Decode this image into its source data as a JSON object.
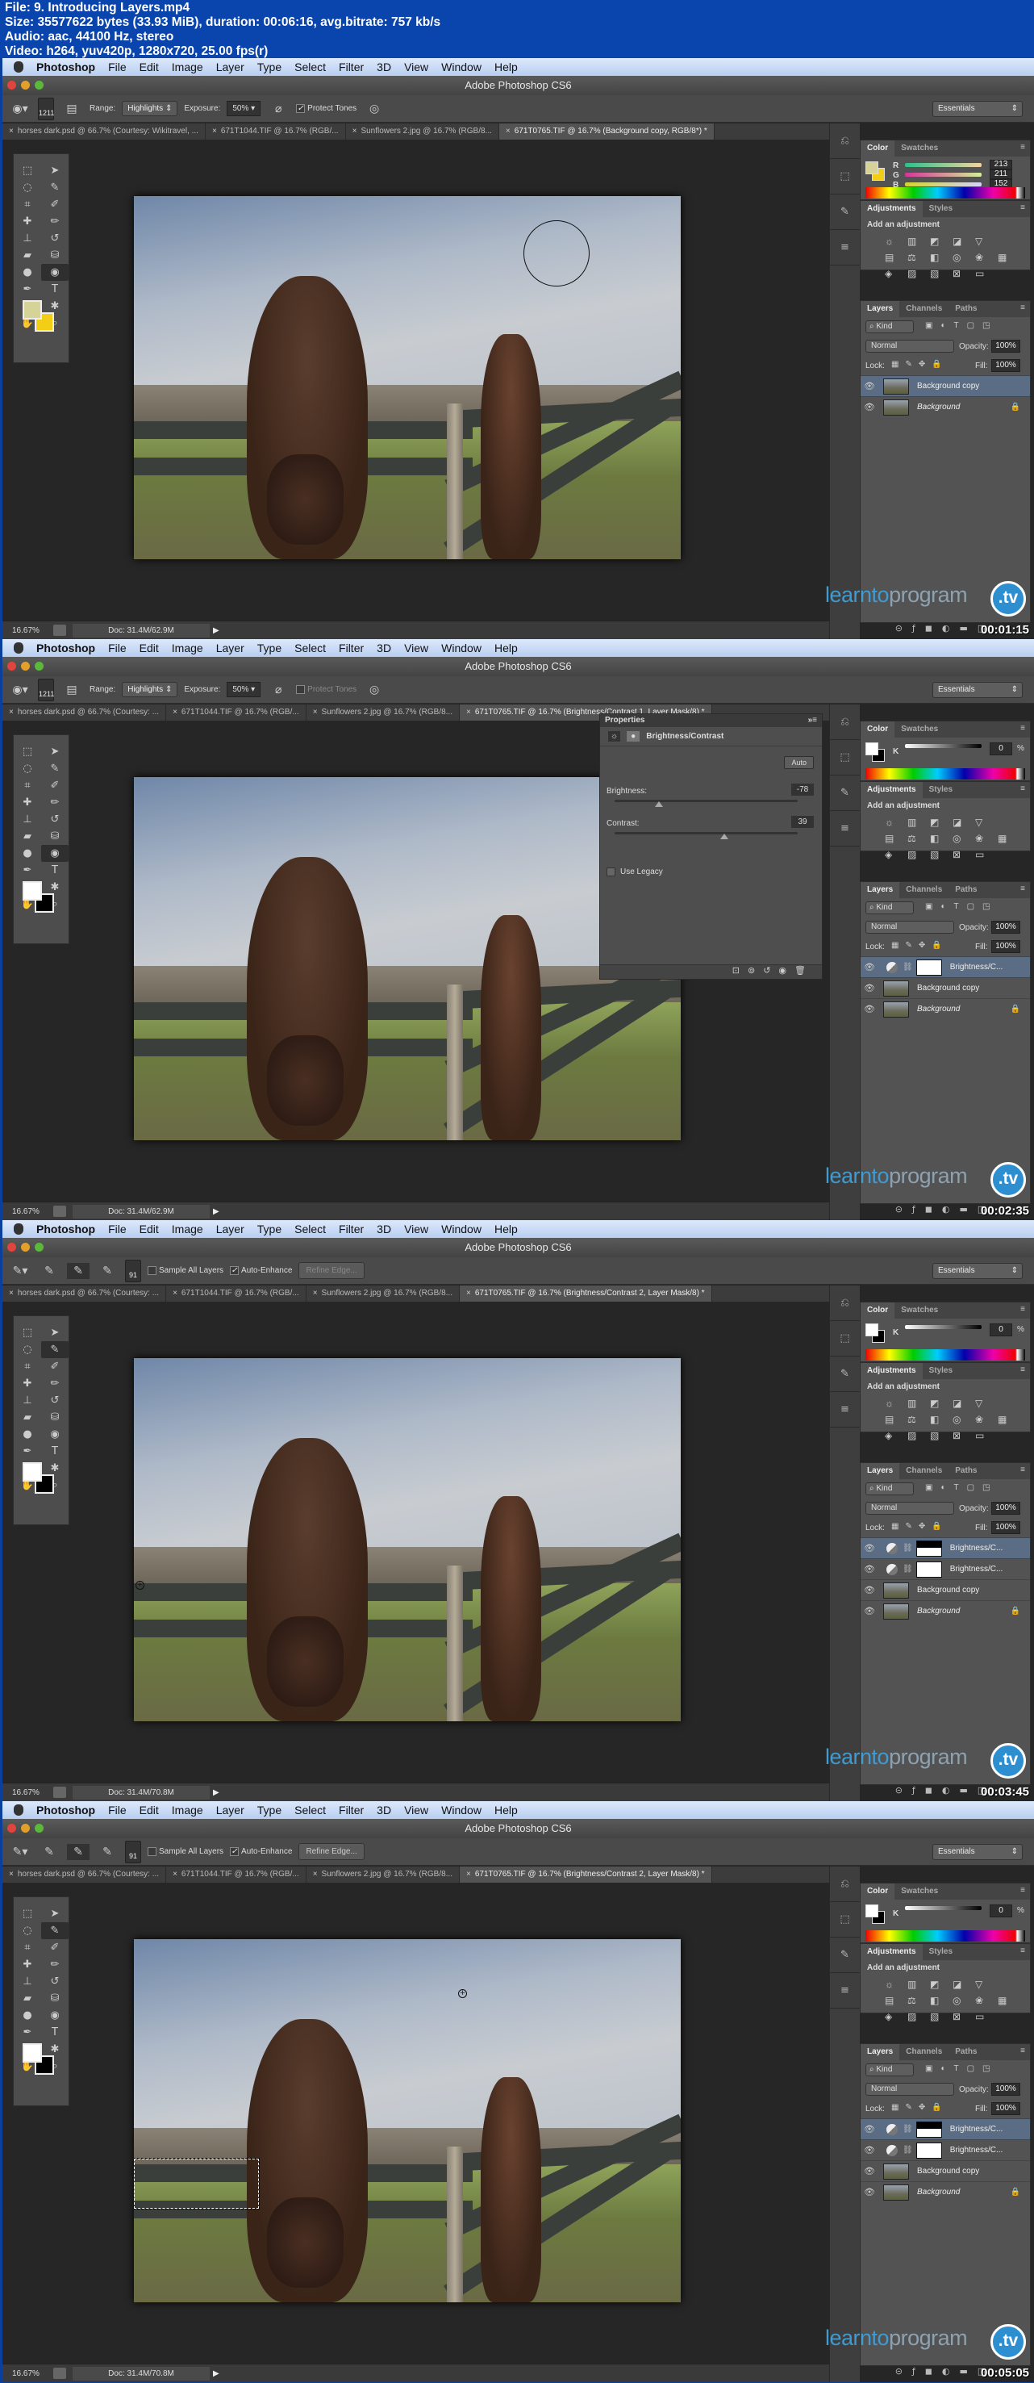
{
  "file_info": {
    "line1": "File: 9. Introducing Layers.mp4",
    "line2": "Size: 35577622 bytes (33.93 MiB), duration: 00:06:16, avg.bitrate: 757 kb/s",
    "line3": "Audio: aac, 44100 Hz, stereo",
    "line4": "Video: h264, yuv420p, 1280x720, 25.00 fps(r)"
  },
  "menu": {
    "app": "Photoshop",
    "items": [
      "File",
      "Edit",
      "Image",
      "Layer",
      "Type",
      "Select",
      "Filter",
      "3D",
      "View",
      "Window",
      "Help"
    ]
  },
  "window_title": "Adobe Photoshop CS6",
  "workspace": "Essentials",
  "logo": {
    "part1": "learnto",
    "part2": "program",
    "badge": ".tv"
  },
  "layer_tabs": [
    "Layers",
    "Channels",
    "Paths"
  ],
  "layer_controls": {
    "kind": "Kind",
    "blend": "Normal",
    "opacity_label": "Opacity:",
    "opacity": "100%",
    "lock_label": "Lock:",
    "fill_label": "Fill:",
    "fill": "100%"
  },
  "color_tabs": [
    "Color",
    "Swatches"
  ],
  "adjust_tabs": [
    "Adjustments",
    "Styles"
  ],
  "adjust_title": "Add an adjustment",
  "frames": [
    {
      "timestamp": "00:01:15",
      "options": {
        "brush_size": "1211",
        "range_label": "Range:",
        "range": "Highlights",
        "exposure_label": "Exposure:",
        "exposure": "50%",
        "protect_tones": "Protect Tones",
        "protect_checked": true
      },
      "doc_tabs": [
        "horses dark.psd @ 66.7% (Courtesy: Wikitravel, ...",
        "671T1044.TIF @ 16.7% (RGB/...",
        "Sunflowers 2.jpg @ 16.7% (RGB/8...",
        "671T0765.TIF @ 16.7% (Background copy, RGB/8*) *"
      ],
      "color": {
        "mode": "RGB",
        "r": "213",
        "g": "211",
        "b": "152",
        "fg": "#d5d398",
        "bg": "#f2cf16"
      },
      "layers": [
        {
          "name": "Background copy",
          "selected": true
        },
        {
          "name": "Background",
          "locked": true
        }
      ],
      "zoom": "16.67%",
      "doc": "Doc: 31.4M/62.9M"
    },
    {
      "timestamp": "00:02:35",
      "options": {
        "brush_size": "1211",
        "range_label": "Range:",
        "range": "Highlights",
        "exposure_label": "Exposure:",
        "exposure": "50%",
        "protect_tones": "Protect Tones",
        "protect_checked": false
      },
      "doc_tabs": [
        "horses dark.psd @ 66.7% (Courtesy: ...",
        "671T1044.TIF @ 16.7% (RGB/...",
        "Sunflowers 2.jpg @ 16.7% (RGB/8...",
        "671T0765.TIF @ 16.7% (Brightness/Contrast 1, Layer Mask/8) *"
      ],
      "color": {
        "mode": "K",
        "k": "0",
        "unit": "%",
        "fg": "#ffffff",
        "bg": "#000000"
      },
      "properties": {
        "title": "Properties",
        "type": "Brightness/Contrast",
        "auto": "Auto",
        "brightness_label": "Brightness:",
        "brightness": "-78",
        "contrast_label": "Contrast:",
        "contrast": "39",
        "legacy": "Use Legacy"
      },
      "layers": [
        {
          "name": "Brightness/C...",
          "selected": true,
          "adjustment": true
        },
        {
          "name": "Background copy"
        },
        {
          "name": "Background",
          "locked": true
        }
      ],
      "zoom": "16.67%",
      "doc": "Doc: 31.4M/62.9M"
    },
    {
      "timestamp": "00:03:45",
      "options": {
        "brush_size": "91",
        "sample_all": "Sample All Layers",
        "auto_enhance": "Auto-Enhance",
        "refine": "Refine Edge..."
      },
      "doc_tabs": [
        "horses dark.psd @ 66.7% (Courtesy: ...",
        "671T1044.TIF @ 16.7% (RGB/...",
        "Sunflowers 2.jpg @ 16.7% (RGB/8...",
        "671T0765.TIF @ 16.7% (Brightness/Contrast 2, Layer Mask/8) *"
      ],
      "color": {
        "mode": "K",
        "k": "0",
        "unit": "%",
        "fg": "#ffffff",
        "bg": "#000000"
      },
      "layers": [
        {
          "name": "Brightness/C...",
          "selected": true,
          "adjustment": true,
          "partial_mask": true
        },
        {
          "name": "Brightness/C...",
          "adjustment": true
        },
        {
          "name": "Background copy"
        },
        {
          "name": "Background",
          "locked": true
        }
      ],
      "zoom": "16.67%",
      "doc": "Doc: 31.4M/70.8M"
    },
    {
      "timestamp": "00:05:05",
      "options": {
        "brush_size": "91",
        "sample_all": "Sample All Layers",
        "auto_enhance": "Auto-Enhance",
        "refine": "Refine Edge..."
      },
      "doc_tabs": [
        "horses dark.psd @ 66.7% (Courtesy: ...",
        "671T1044.TIF @ 16.7% (RGB/...",
        "Sunflowers 2.jpg @ 16.7% (RGB/8...",
        "671T0765.TIF @ 16.7% (Brightness/Contrast 2, Layer Mask/8) *"
      ],
      "color": {
        "mode": "K",
        "k": "0",
        "unit": "%",
        "fg": "#ffffff",
        "bg": "#000000"
      },
      "layers": [
        {
          "name": "Brightness/C...",
          "selected": true,
          "adjustment": true,
          "partial_mask": true
        },
        {
          "name": "Brightness/C...",
          "adjustment": true
        },
        {
          "name": "Background copy"
        },
        {
          "name": "Background",
          "locked": true
        }
      ],
      "zoom": "16.67%",
      "doc": "Doc: 31.4M/70.8M"
    }
  ]
}
